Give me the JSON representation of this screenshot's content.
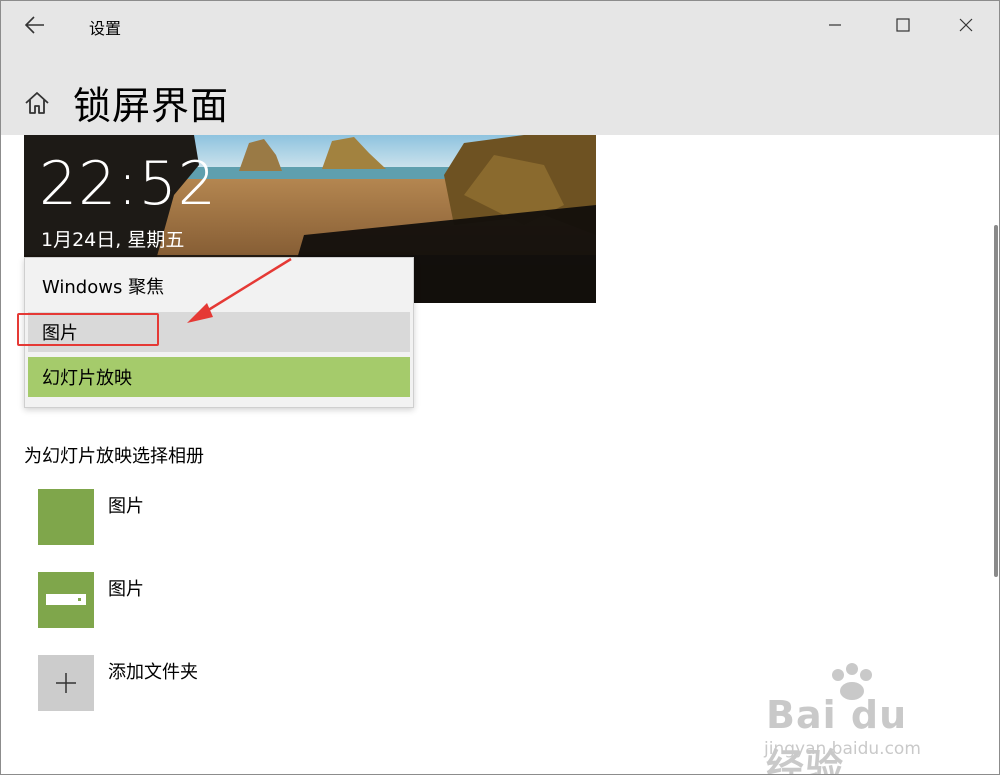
{
  "window": {
    "title": "设置"
  },
  "header": {
    "page_title": "锁屏界面"
  },
  "preview": {
    "time": "22:52",
    "date": "1月24日, 星期五"
  },
  "dropdown": {
    "options": [
      "Windows 聚焦",
      "图片",
      "幻灯片放映"
    ],
    "selected": "幻灯片放映",
    "hovered": "图片"
  },
  "albums": {
    "label": "为幻灯片放映选择相册",
    "items": [
      {
        "name": "图片",
        "icon": "photo-tile"
      },
      {
        "name": "图片",
        "icon": "drive-icon"
      },
      {
        "name": "添加文件夹",
        "icon": "plus-icon"
      }
    ]
  },
  "colors": {
    "accent_green": "#7fa64b",
    "selected_option": "#a5cb6b",
    "annotation_red": "#e53935"
  },
  "watermark": {
    "brand": "Bai du 经验",
    "url": "jingyan.baidu.com"
  }
}
